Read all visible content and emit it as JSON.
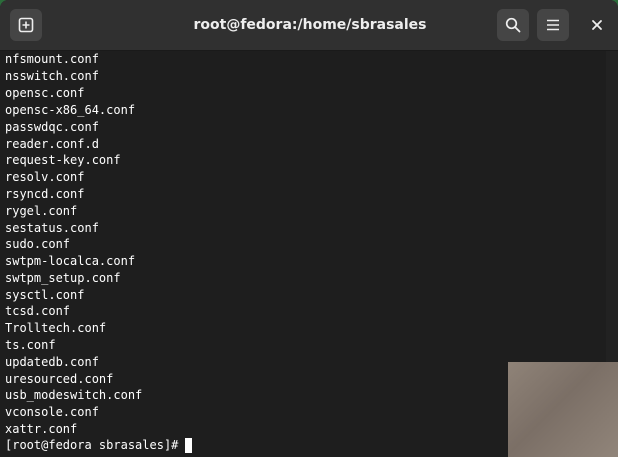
{
  "window": {
    "title": "root@fedora:/home/sbrasales"
  },
  "headerbar": {
    "new_tab_icon": "new-tab-icon",
    "search_icon": "search-icon",
    "menu_icon": "hamburger-menu-icon",
    "close_icon": "close-icon"
  },
  "terminal": {
    "lines": [
      "nfsmount.conf",
      "nsswitch.conf",
      "opensc.conf",
      "opensc-x86_64.conf",
      "passwdqc.conf",
      "reader.conf.d",
      "request-key.conf",
      "resolv.conf",
      "rsyncd.conf",
      "rygel.conf",
      "sestatus.conf",
      "sudo.conf",
      "swtpm-localca.conf",
      "swtpm_setup.conf",
      "sysctl.conf",
      "tcsd.conf",
      "Trolltech.conf",
      "ts.conf",
      "updatedb.conf",
      "uresourced.conf",
      "usb_modeswitch.conf",
      "vconsole.conf",
      "xattr.conf"
    ],
    "prompt": "[root@fedora sbrasales]#"
  },
  "colors": {
    "terminal_bg": "#1e1e1e",
    "headerbar_bg": "#303030",
    "text": "#ffffff"
  }
}
